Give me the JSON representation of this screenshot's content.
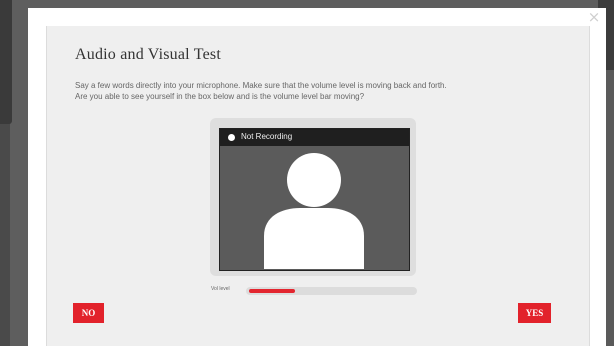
{
  "modal": {
    "title": "Audio and Visual Test",
    "description_line1": "Say a few words directly into your microphone. Make sure that the volume level is moving back and forth.",
    "description_line2": "Are you able to see yourself in the box below and is the volume level bar moving?",
    "close_icon": "×"
  },
  "video": {
    "status": "Not Recording",
    "placeholder_icon": "user-silhouette-icon"
  },
  "volume": {
    "label": "Vol level",
    "level_fraction": 0.28,
    "color": "#e3262f"
  },
  "buttons": {
    "no_label": "NO",
    "yes_label": "YES",
    "color": "#e2222b"
  }
}
